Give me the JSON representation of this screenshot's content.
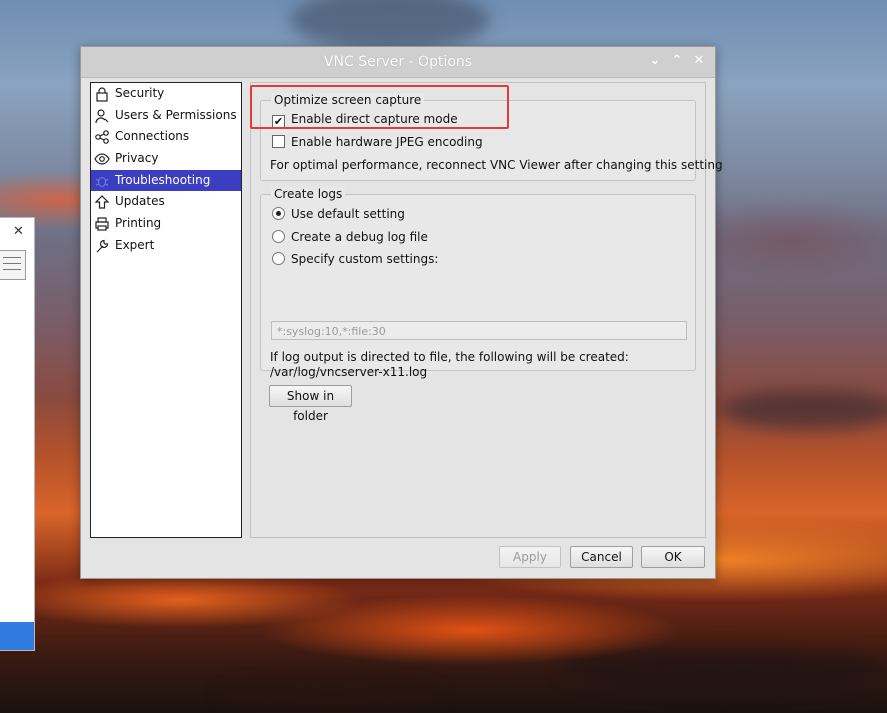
{
  "window": {
    "title": "VNC Server - Options",
    "controls": {
      "minimize": "⌄",
      "maximize": "⌃",
      "close": "✕"
    }
  },
  "sidebar": {
    "items": [
      {
        "label": "Security",
        "icon": "lock-icon"
      },
      {
        "label": "Users & Permissions",
        "icon": "user-icon"
      },
      {
        "label": "Connections",
        "icon": "share-icon"
      },
      {
        "label": "Privacy",
        "icon": "eye-icon"
      },
      {
        "label": "Troubleshooting",
        "icon": "bug-icon",
        "active": true
      },
      {
        "label": "Updates",
        "icon": "update-icon"
      },
      {
        "label": "Printing",
        "icon": "printer-icon"
      },
      {
        "label": "Expert",
        "icon": "wrench-icon"
      }
    ]
  },
  "optimize": {
    "group_title": "Optimize screen capture",
    "direct_capture_label": "Enable direct capture mode",
    "direct_capture_checked": true,
    "jpeg_label": "Enable hardware JPEG encoding",
    "jpeg_checked": false,
    "note": "For optimal performance, reconnect VNC Viewer after changing this setting"
  },
  "logs": {
    "group_title": "Create logs",
    "options": [
      {
        "label": "Use default setting",
        "selected": true
      },
      {
        "label": "Create a debug log file",
        "selected": false
      },
      {
        "label": "Specify custom settings:",
        "selected": false
      }
    ],
    "custom_placeholder": "*:syslog:10,*:file:30",
    "info_line1": "If log output is directed to file, the following will be created:",
    "info_line2": "/var/log/vncserver-x11.log",
    "show_folder_label": "Show in folder"
  },
  "footer": {
    "apply_label": "Apply",
    "cancel_label": "Cancel",
    "ok_label": "OK"
  },
  "left_window": {
    "close": "✕"
  },
  "colors": {
    "active_nav": "#3b3ec0",
    "highlight": "#e23b3b",
    "title_text": "#ffffff"
  }
}
